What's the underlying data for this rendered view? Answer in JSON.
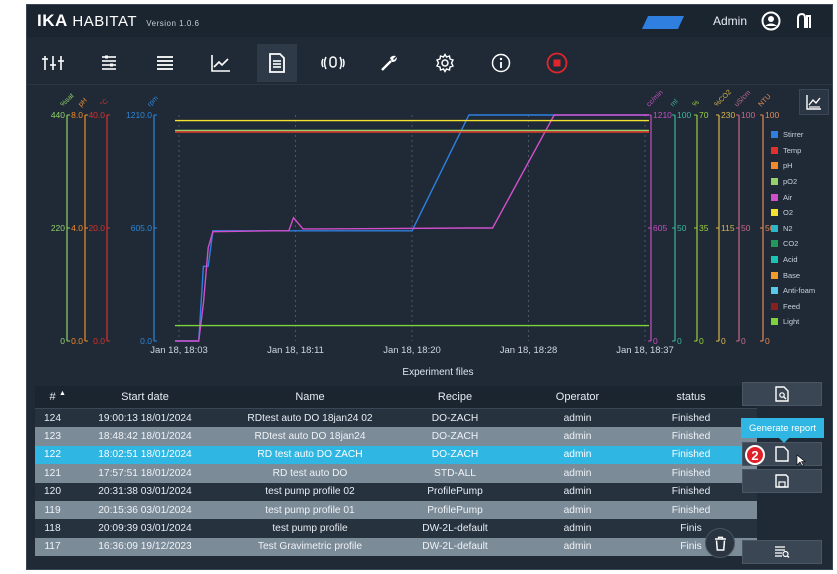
{
  "app": {
    "brand": "IKA",
    "brand_product": "HABITAT",
    "version": "Version 1.0.6",
    "user": "Admin"
  },
  "toolbar": {
    "items": [
      "dashboard-icon",
      "parameters-icon",
      "list-icon",
      "trend-icon",
      "experiment-files-icon",
      "sound-icon",
      "tools-icon",
      "settings-icon",
      "info-icon",
      "stop-icon"
    ],
    "active": "experiment-files-icon"
  },
  "chart_data": {
    "type": "line",
    "x": [
      "Jan 18, 18:03",
      "Jan 18, 18:11",
      "Jan 18, 18:20",
      "Jan 18, 18:28",
      "Jan 18, 18:37"
    ],
    "left_axes": [
      {
        "label": "%sat",
        "ticks": [
          "440",
          "220",
          "0"
        ],
        "color": "#8fcf6a"
      },
      {
        "label": "pH",
        "ticks": [
          "8.0",
          "4.0",
          "0.0"
        ],
        "color": "#f28a2a"
      },
      {
        "label": "°C",
        "ticks": [
          "40.0",
          "20.0",
          "0.0"
        ],
        "color": "#d9302b"
      },
      {
        "label": "rpm",
        "ticks": [
          "1210.0",
          "605.0",
          "0.0"
        ],
        "color": "#2f86d8"
      }
    ],
    "right_axes": [
      {
        "label": "cc/min",
        "ticks": [
          "1210",
          "605",
          "0"
        ],
        "color": "#c54fbf"
      },
      {
        "label": "ml",
        "ticks": [
          "100",
          "50",
          "0"
        ],
        "color": "#3fb49a"
      },
      {
        "label": "%",
        "ticks": [
          "70",
          "35",
          "0"
        ],
        "color": "#9ccf3c"
      },
      {
        "label": "%CO2",
        "ticks": [
          "230",
          "115",
          "0"
        ],
        "color": "#d9b54a"
      },
      {
        "label": "uS/cm",
        "ticks": [
          "100",
          "50",
          "0"
        ],
        "color": "#c56a8a"
      },
      {
        "label": "NTU",
        "ticks": [
          "100",
          "50",
          "0"
        ],
        "color": "#e08a55"
      }
    ],
    "legend": [
      {
        "name": "Stirrer",
        "color": "#2f7fe0"
      },
      {
        "name": "Temp",
        "color": "#e0312f"
      },
      {
        "name": "pH",
        "color": "#f28a2a"
      },
      {
        "name": "pO2",
        "color": "#93d26a"
      },
      {
        "name": "Air",
        "color": "#d14fcb"
      },
      {
        "name": "O2",
        "color": "#f2e12e"
      },
      {
        "name": "N2",
        "color": "#2bb6c9"
      },
      {
        "name": "CO2",
        "color": "#1f9a5a"
      },
      {
        "name": "Acid",
        "color": "#19c4b5"
      },
      {
        "name": "Base",
        "color": "#f49a28"
      },
      {
        "name": "Anti-foam",
        "color": "#58c8e8"
      },
      {
        "name": "Feed",
        "color": "#8a1f1f"
      },
      {
        "name": "Light",
        "color": "#7ed33a"
      }
    ],
    "series": [
      {
        "name": "Stirrer",
        "x": [
          0,
          0.03,
          0.05,
          0.06,
          0.07,
          0.08,
          0.2,
          0.4,
          0.5,
          0.62,
          0.64,
          0.75,
          0.85,
          1.0
        ],
        "y": [
          0,
          0,
          0,
          400,
          400,
          590,
          590,
          590,
          590,
          1210,
          1210,
          1210,
          1210,
          1210
        ]
      },
      {
        "name": "Air",
        "x": [
          0,
          0.05,
          0.06,
          0.07,
          0.08,
          0.2,
          0.24,
          0.25,
          0.27,
          0.3,
          0.62,
          0.64,
          0.67,
          0.8,
          0.82,
          0.9,
          1.0
        ],
        "y": [
          0,
          0,
          200,
          500,
          585,
          590,
          590,
          660,
          600,
          600,
          605,
          605,
          605,
          1210,
          1210,
          1210,
          1210
        ]
      },
      {
        "name": "pO2",
        "x": [
          0,
          1
        ],
        "y": [
          410,
          410
        ]
      },
      {
        "name": "O2",
        "x": [
          0,
          1
        ],
        "y": [
          1180,
          1180
        ]
      },
      {
        "name": "pH",
        "x": [
          0,
          1
        ],
        "y": [
          7.4,
          7.4
        ]
      },
      {
        "name": "Temp",
        "x": [
          0,
          1
        ],
        "y": [
          37,
          37
        ]
      },
      {
        "name": "Light",
        "x": [
          0,
          1
        ],
        "y": [
          30,
          30
        ]
      }
    ]
  },
  "chart_button": "chart-view-icon",
  "experiment_files": {
    "title": "Experiment files",
    "columns": [
      "#",
      "Start date",
      "Name",
      "Recipe",
      "Operator",
      "status"
    ],
    "rows": [
      {
        "id": "124",
        "date": "19:00:13 18/01/2024",
        "name": "RDtest auto DO 18jan24 02",
        "recipe": "DO-ZACH",
        "op": "admin",
        "status": "Finished"
      },
      {
        "id": "123",
        "date": "18:48:42 18/01/2024",
        "name": "RDtest auto DO 18jan24",
        "recipe": "DO-ZACH",
        "op": "admin",
        "status": "Finished"
      },
      {
        "id": "122",
        "date": "18:02:51 18/01/2024",
        "name": "RD test auto DO ZACH",
        "recipe": "DO-ZACH",
        "op": "admin",
        "status": "Finished"
      },
      {
        "id": "121",
        "date": "17:57:51 18/01/2024",
        "name": "RD test auto DO",
        "recipe": "STD-ALL",
        "op": "admin",
        "status": "Finished"
      },
      {
        "id": "120",
        "date": "20:31:38 03/01/2024",
        "name": "test pump profile 02",
        "recipe": "ProfilePump",
        "op": "admin",
        "status": "Finished"
      },
      {
        "id": "119",
        "date": "20:15:36 03/01/2024",
        "name": "test pump profile 01",
        "recipe": "ProfilePump",
        "op": "admin",
        "status": "Finished"
      },
      {
        "id": "118",
        "date": "20:09:39 03/01/2024",
        "name": "test pump profile",
        "recipe": "DW-2L-default",
        "op": "admin",
        "status": "Finis"
      },
      {
        "id": "117",
        "date": "16:36:09 19/12/2023",
        "name": "Test Gravimetric profile",
        "recipe": "DW-2L-default",
        "op": "admin",
        "status": "Finis"
      }
    ],
    "selected_index": 2
  },
  "tooltip": "Generate report",
  "step_badge": "2"
}
